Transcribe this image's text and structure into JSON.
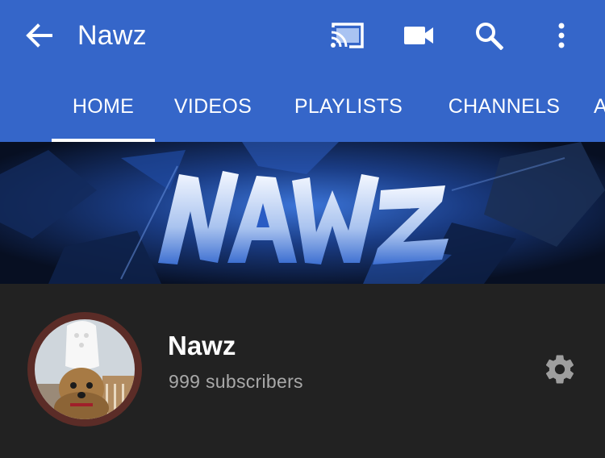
{
  "app_bar": {
    "title": "Nawz",
    "background_color": "#3566c9",
    "icons": [
      "arrow-back-icon",
      "cast-icon",
      "video-camera-icon",
      "search-icon",
      "more-vert-icon"
    ]
  },
  "tabs": [
    {
      "label": "HOME",
      "active": true
    },
    {
      "label": "VIDEOS",
      "active": false
    },
    {
      "label": "PLAYLISTS",
      "active": false
    },
    {
      "label": "CHANNELS",
      "active": false
    },
    {
      "label": "A",
      "active": false
    }
  ],
  "banner": {
    "logo_text": "NAWZ",
    "theme_color": "#2a5cc4"
  },
  "channel": {
    "name": "Nawz",
    "subscribers": "999 subscribers",
    "avatar_ring_color": "#5b2c27",
    "settings_icon": "gear-icon"
  }
}
